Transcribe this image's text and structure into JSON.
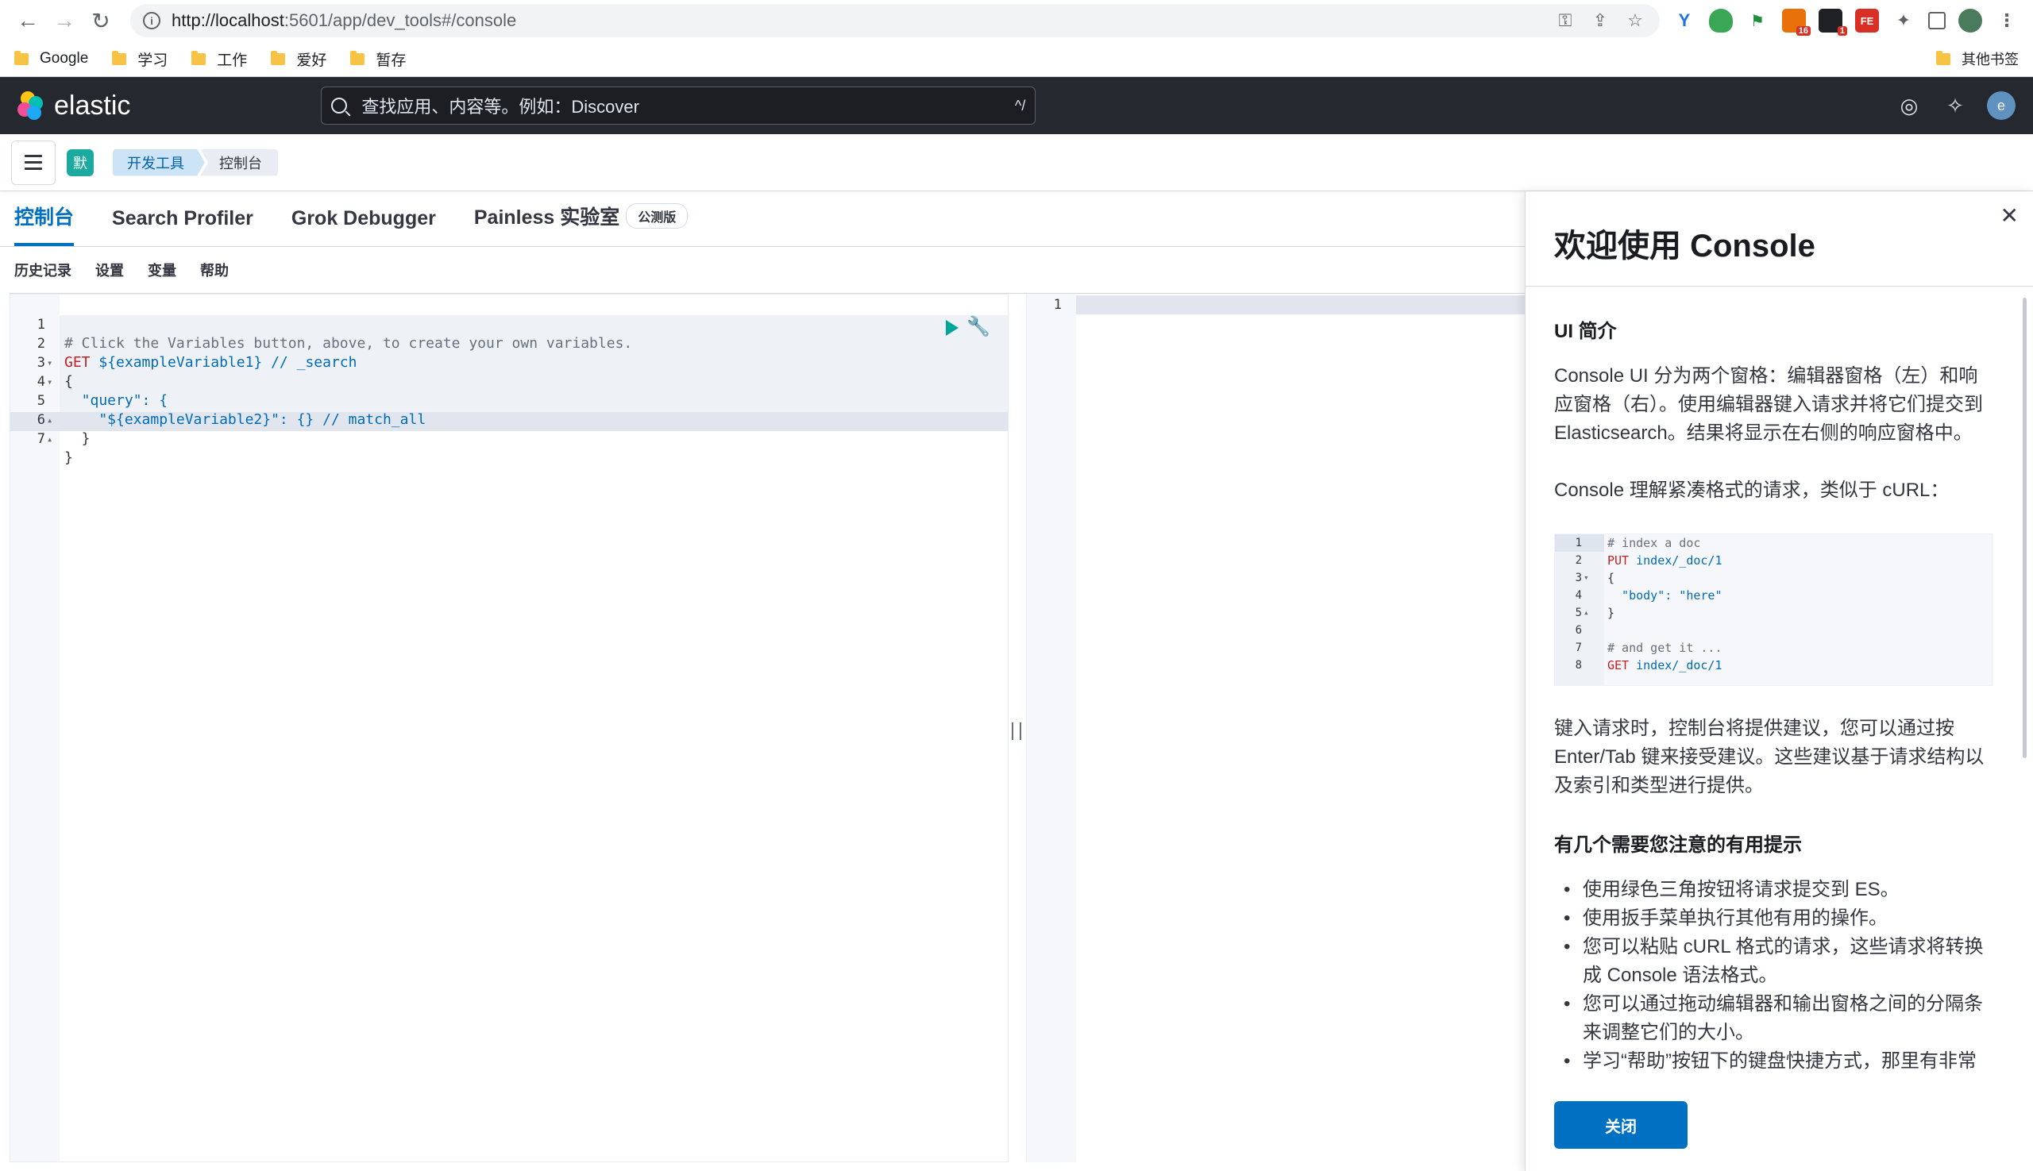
{
  "browser": {
    "url_host": "http://localhost",
    "url_rest": ":5601/app/dev_tools#/console",
    "bookmarks": [
      "Google",
      "学习",
      "工作",
      "爱好",
      "暂存"
    ],
    "other_bookmarks": "其他书签",
    "ext_badge_1": "16",
    "ext_badge_2": "1",
    "ext_label_3": "FE"
  },
  "header": {
    "logo_text": "elastic",
    "search_placeholder": "查找应用、内容等。例如：Discover",
    "search_shortcut": "^/",
    "avatar_initial": "e"
  },
  "breadcrumbs": {
    "space_initial": "默",
    "items": [
      "开发工具",
      "控制台"
    ]
  },
  "tabs": [
    {
      "label": "控制台"
    },
    {
      "label": "Search Profiler"
    },
    {
      "label": "Grok Debugger"
    },
    {
      "label": "Painless 实验室"
    }
  ],
  "beta_badge": "公测版",
  "toolbar": {
    "history": "历史记录",
    "settings": "设置",
    "variables": "变量",
    "help": "帮助"
  },
  "editor": {
    "lines": [
      {
        "n": "1",
        "fold": "",
        "code": "# Click the Variables button, above, to create your own variables."
      },
      {
        "n": "2",
        "fold": "",
        "method": "GET",
        "code": " ${exampleVariable1} // _search"
      },
      {
        "n": "3",
        "fold": "▾",
        "code": "{"
      },
      {
        "n": "4",
        "fold": "▾",
        "code": "  \"query\": {"
      },
      {
        "n": "5",
        "fold": "",
        "code": "    \"${exampleVariable2}\": {} // match_all"
      },
      {
        "n": "6",
        "fold": "▴",
        "code": "  }"
      },
      {
        "n": "7",
        "fold": "▴",
        "code": "}"
      }
    ],
    "output_line": "1"
  },
  "flyout": {
    "title": "欢迎使用 Console",
    "section1_title": "UI 简介",
    "p1": "Console UI 分为两个窗格：编辑器窗格（左）和响应窗格（右）。使用编辑器键入请求并将它们提交到 Elasticsearch。结果将显示在右侧的响应窗格中。",
    "p2": "Console 理解紧凑格式的请求，类似于 cURL：",
    "sample": [
      {
        "n": "1",
        "fold": "",
        "code": "# index a doc"
      },
      {
        "n": "2",
        "fold": "",
        "method": "PUT",
        "code": " index/_doc/1"
      },
      {
        "n": "3",
        "fold": "▾",
        "code": "{"
      },
      {
        "n": "4",
        "fold": "",
        "code": "  \"body\": \"here\""
      },
      {
        "n": "5",
        "fold": "▴",
        "code": "}"
      },
      {
        "n": "6",
        "fold": "",
        "code": ""
      },
      {
        "n": "7",
        "fold": "",
        "code": "# and get it ..."
      },
      {
        "n": "8",
        "fold": "",
        "method": "GET",
        "code": " index/_doc/1"
      }
    ],
    "p3": "键入请求时，控制台将提供建议，您可以通过按 Enter/Tab 键来接受建议。这些建议基于请求结构以及索引和类型进行提供。",
    "section2_title": "有几个需要您注意的有用提示",
    "tips": [
      "使用绿色三角按钮将请求提交到 ES。",
      "使用扳手菜单执行其他有用的操作。",
      "您可以粘贴 cURL 格式的请求，这些请求将转换成 Console 语法格式。",
      "您可以通过拖动编辑器和输出窗格之间的分隔条来调整它们的大小。",
      "学习“帮助”按钮下的键盘快捷方式，那里有非常"
    ],
    "close_label": "关闭"
  }
}
